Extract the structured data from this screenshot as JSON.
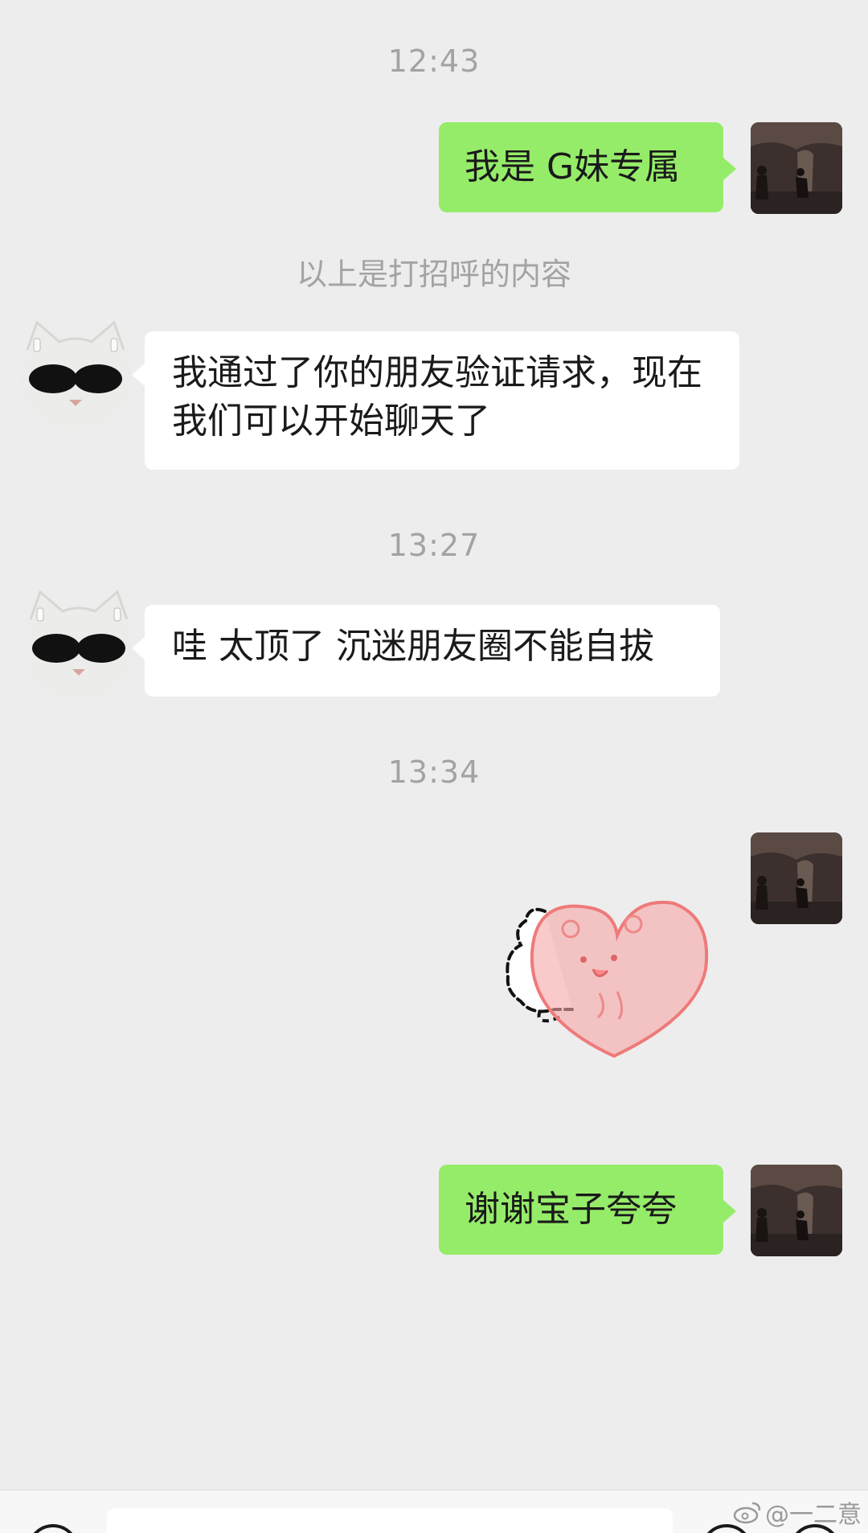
{
  "chat": {
    "time_1": "12:43",
    "time_2": "13:27",
    "time_3": "13:34",
    "system_note": "以上是打招呼的内容"
  },
  "messages": [
    {
      "sender": "me",
      "type": "text",
      "text": "我是 G妹专属"
    },
    {
      "sender": "other",
      "type": "text",
      "text": "我通过了你的朋友验证请求，现在我们可以开始聊天了"
    },
    {
      "sender": "other",
      "type": "text",
      "text": "哇 太顶了 沉迷朋友圈不能自拔"
    },
    {
      "sender": "me",
      "type": "sticker",
      "sticker": "bear-hugging-heart-sticker"
    },
    {
      "sender": "me",
      "type": "text",
      "text": "谢谢宝子夸夸"
    }
  ],
  "watermark": {
    "text": "@一二意",
    "icon": "weibo-icon"
  },
  "colors": {
    "background": "#ededed",
    "my_bubble": "#95ec69",
    "their_bubble": "#ffffff",
    "timestamp": "#a3a3a3"
  }
}
